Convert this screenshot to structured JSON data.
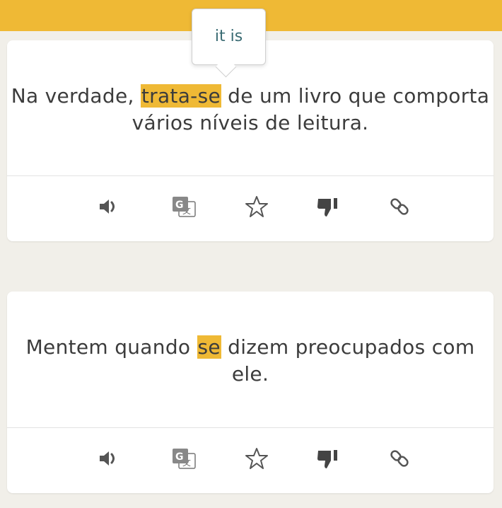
{
  "header": {
    "decorative_text": ""
  },
  "tooltip": {
    "text": "it is"
  },
  "cards": [
    {
      "sentence": {
        "before": "Na verdade, ",
        "highlight": "trata-se",
        "after": " de um livro que comporta vários níveis de leitura."
      }
    },
    {
      "sentence": {
        "before": "Mentem quando ",
        "highlight": "se",
        "after": " dizem preocupados com ele."
      }
    }
  ],
  "actions": [
    "speaker-icon",
    "google-translate-icon",
    "star-icon",
    "thumbs-down-icon",
    "link-icon"
  ],
  "colors": {
    "accent": "#efb935",
    "tooltip_text": "#3a6b73",
    "icon_gray": "#555555"
  }
}
